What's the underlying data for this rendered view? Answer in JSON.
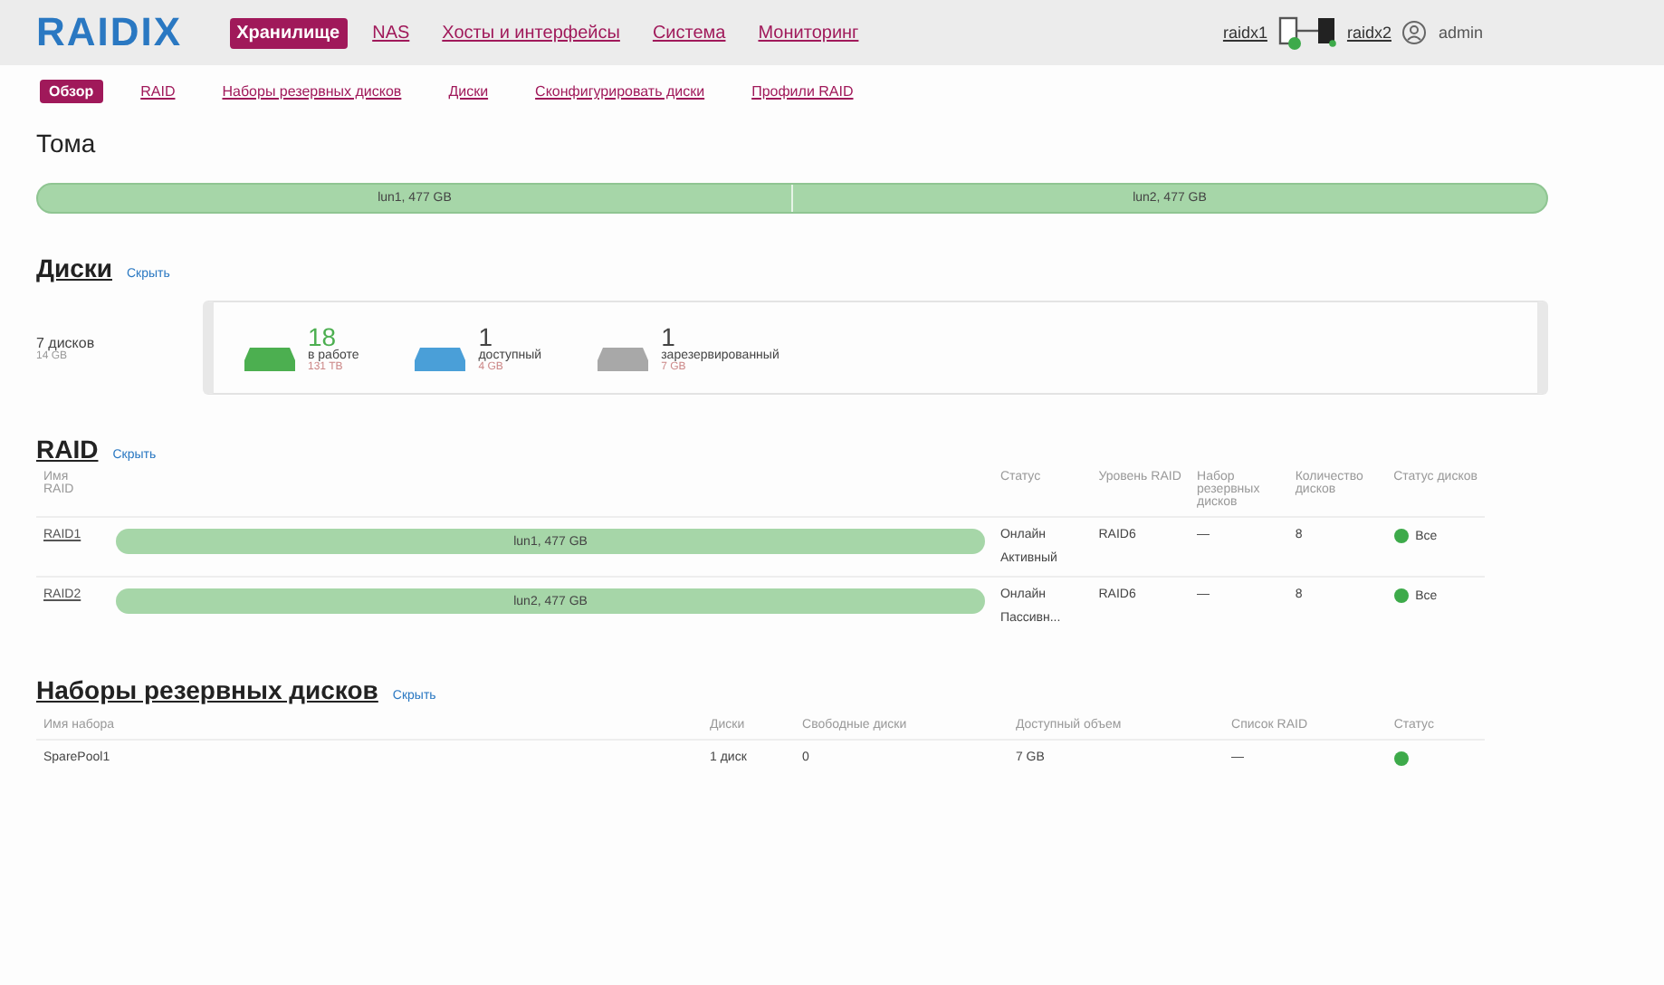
{
  "header": {
    "logo": "RAIDIX",
    "tabs": [
      {
        "label": "Хранилище",
        "selected": true
      },
      {
        "label": "NAS",
        "selected": false
      },
      {
        "label": "Хосты и интерфейсы",
        "selected": false
      },
      {
        "label": "Система",
        "selected": false
      },
      {
        "label": "Мониторинг",
        "selected": false
      }
    ],
    "node_left": "raidx1",
    "node_right": "raidx2",
    "user": "admin"
  },
  "subnav": [
    {
      "label": "Обзор",
      "selected": true
    },
    {
      "label": "RAID",
      "selected": false
    },
    {
      "label": "Наборы резервных дисков",
      "selected": false
    },
    {
      "label": "Диски",
      "selected": false
    },
    {
      "label": "Сконфигурировать диски",
      "selected": false
    },
    {
      "label": "Профили RAID",
      "selected": false
    }
  ],
  "volumes": {
    "title": "Тома",
    "segments": [
      "lun1, 477 GB",
      "lun2, 477 GB"
    ]
  },
  "disks": {
    "title": "Диски",
    "toggle": "Скрыть",
    "total": "7 дисков",
    "total_size": "14 GB",
    "groups": [
      {
        "count": "18",
        "label": "в работе",
        "size": "131 TB",
        "color": "#4caf50"
      },
      {
        "count": "1",
        "label": "доступный",
        "size": "4 GB",
        "color": "#4a9fd8"
      },
      {
        "count": "1",
        "label": "зарезервированный",
        "size": "7 GB",
        "color": "#a8a8a8"
      }
    ]
  },
  "raid": {
    "title": "RAID",
    "toggle": "Скрыть",
    "columns": [
      "Имя RAID",
      "Статус",
      "Уровень RAID",
      "Набор резервных дисков",
      "Количество дисков",
      "Статус дисков"
    ],
    "rows": [
      {
        "name": "RAID1",
        "bar": "lun1, 477 GB",
        "status": "Онлайн",
        "role": "Активный",
        "level": "RAID6",
        "spare": "—",
        "count": "8",
        "disks": "Все",
        "color": "#3daa4a"
      },
      {
        "name": "RAID2",
        "bar": "lun2, 477 GB",
        "status": "Онлайн",
        "role": "Пассивн...",
        "level": "RAID6",
        "spare": "—",
        "count": "8",
        "disks": "Все",
        "color": "#3daa4a"
      }
    ]
  },
  "spares": {
    "title": "Наборы резервных дисков",
    "toggle": "Скрыть",
    "columns": [
      "Имя набора",
      "Диски",
      "Свободные диски",
      "Доступный объем",
      "Список RAID",
      "Статус"
    ],
    "rows": [
      {
        "name": "SparePool1",
        "disks": "1 диск",
        "free": "0",
        "capacity": "7 GB",
        "raids": "—",
        "color": "#3daa4a"
      }
    ]
  }
}
